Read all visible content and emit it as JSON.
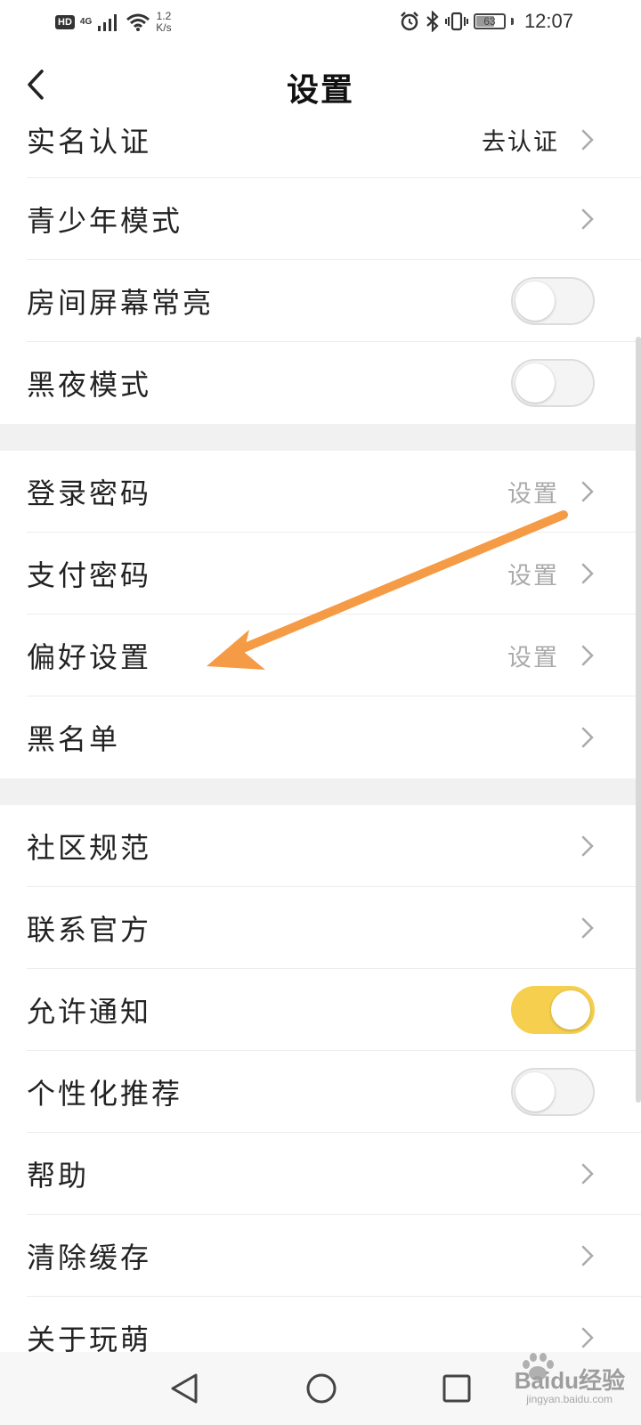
{
  "status_bar": {
    "hd": "HD",
    "network": "4G",
    "speed_value": "1.2",
    "speed_unit": "K/s",
    "battery": "63",
    "time": "12:07"
  },
  "header": {
    "title": "设置"
  },
  "settings": {
    "real_name": {
      "label": "实名认证",
      "value": "去认证"
    },
    "teen_mode": {
      "label": "青少年模式"
    },
    "screen_on": {
      "label": "房间屏幕常亮",
      "enabled": false
    },
    "night_mode": {
      "label": "黑夜模式",
      "enabled": false
    },
    "login_password": {
      "label": "登录密码",
      "value": "设置"
    },
    "pay_password": {
      "label": "支付密码",
      "value": "设置"
    },
    "preferences": {
      "label": "偏好设置",
      "value": "设置"
    },
    "blacklist": {
      "label": "黑名单"
    },
    "community_rules": {
      "label": "社区规范"
    },
    "contact_official": {
      "label": "联系官方"
    },
    "allow_notifications": {
      "label": "允许通知",
      "enabled": true
    },
    "personalized_recommend": {
      "label": "个性化推荐",
      "enabled": false
    },
    "help": {
      "label": "帮助"
    },
    "clear_cache": {
      "label": "清除缓存"
    },
    "about": {
      "label": "关于玩萌"
    }
  },
  "colors": {
    "toggle_on": "#f5cf4d",
    "annotation_arrow": "#f59b45",
    "secondary_text": "#aaaaaa"
  },
  "watermark": {
    "main": "Baidu经验",
    "sub": "jingyan.baidu.com"
  }
}
